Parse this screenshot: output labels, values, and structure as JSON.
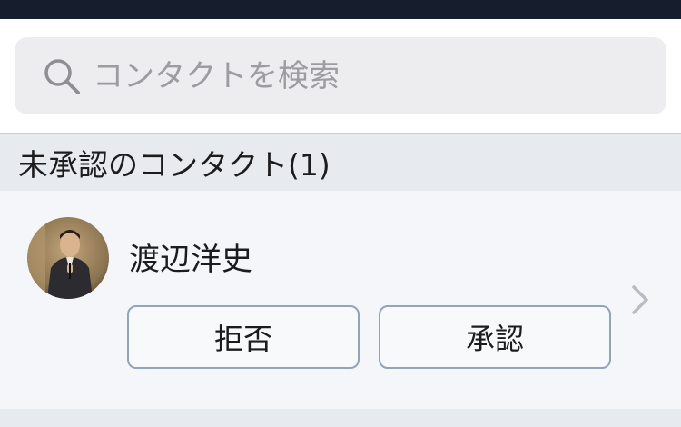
{
  "search": {
    "placeholder": "コンタクトを検索",
    "icon": "search-icon"
  },
  "pending_section": {
    "title": "未承認のコンタクト(1)"
  },
  "contacts": [
    {
      "name": "渡辺洋史",
      "avatar": "photo",
      "reject_label": "拒否",
      "approve_label": "承認",
      "chevron_icon": "chevron-right-icon"
    }
  ],
  "colors": {
    "status_bar": "#161e2e",
    "search_bg": "#ededf0",
    "section_bg": "#e7eaee",
    "row_bg": "#f4f6f9",
    "button_border": "#93a3b8"
  }
}
